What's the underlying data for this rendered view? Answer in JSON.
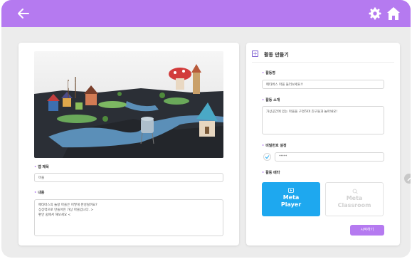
{
  "colors": {
    "accent": "#b57af0",
    "player": "#1ea8ef",
    "bg": "#ececec"
  },
  "topbar": {
    "back_icon": "arrow-left-icon",
    "settings_icon": "gear-icon",
    "home_icon": "home-icon"
  },
  "map_form": {
    "name_label": "맵 제목",
    "name_value": "마을",
    "description_label": "내용",
    "description_lines": [
      "메타버스의 놀랑 마을은 어떻게 완성될까요?",
      "상상력으로 만들어진 가상 마을입니다. >",
      "편안 쉼에서 해보세요 <"
    ]
  },
  "activity_form": {
    "title": "활동 만들기",
    "activity_name_label": "활동명",
    "activity_name_value": "메타버스 마을 둘러보세요!!",
    "intro_label": "활동 소개",
    "intro_value": "가상공간에 있는 마을을 구경하며 친구들과 놀아봐요!",
    "password_label": "비밀번호 설정",
    "password_value": "*****",
    "mode_label": "활동 매타",
    "player_line1": "Meta",
    "player_line2": "Player",
    "classroom_line1": "Meta",
    "classroom_line2": "Classroom",
    "start_label": "시작하기"
  }
}
